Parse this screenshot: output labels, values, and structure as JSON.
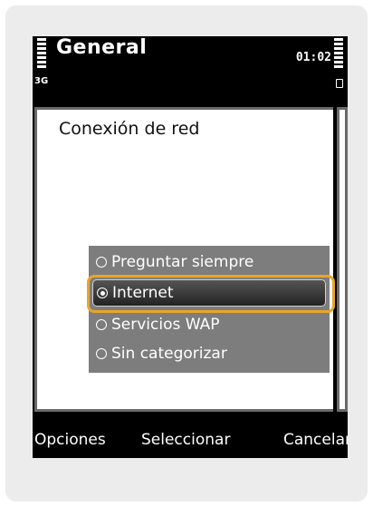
{
  "status": {
    "title": "General",
    "network": "3G",
    "time": "01:02"
  },
  "content": {
    "heading": "Conexión de red"
  },
  "options": [
    {
      "label": "Preguntar siempre",
      "selected": false
    },
    {
      "label": "Internet",
      "selected": true
    },
    {
      "label": "Servicios WAP",
      "selected": false
    },
    {
      "label": "Sin categorizar",
      "selected": false
    }
  ],
  "softkeys": {
    "left": "Opciones",
    "middle": "Seleccionar",
    "right": "Cancelar"
  },
  "colors": {
    "highlight": "#e8a52a",
    "popup": "#7d7d7d"
  }
}
